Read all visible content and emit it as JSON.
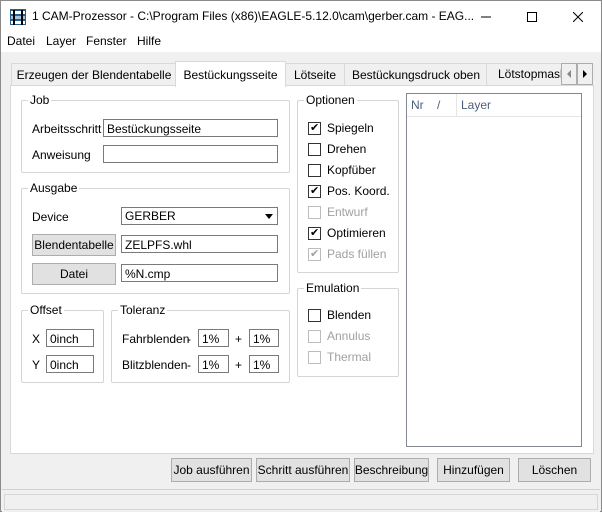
{
  "window": {
    "title": "1 CAM-Prozessor - C:\\Program Files (x86)\\EAGLE-5.12.0\\cam\\gerber.cam - EAG...",
    "minimize_icon": "minimize-icon",
    "maximize_icon": "maximize-icon",
    "close_icon": "close-icon"
  },
  "menu": [
    "Datei",
    "Layer",
    "Fenster",
    "Hilfe"
  ],
  "tabs": [
    {
      "label": "Erzeugen der Blendentabelle"
    },
    {
      "label": "Bestückungsseite"
    },
    {
      "label": "Lötseite"
    },
    {
      "label": "Bestückungsdruck oben"
    },
    {
      "label": "Lötstopmaske"
    }
  ],
  "active_tab": "Bestückungsseite",
  "job": {
    "title": "Job",
    "step_label": "Arbeitsschritt",
    "step_value": "Bestückungsseite",
    "instruction_label": "Anweisung",
    "instruction_value": ""
  },
  "output": {
    "title": "Ausgabe",
    "device_label": "Device",
    "device_value": "GERBER",
    "aperture_button": "Blendentabelle",
    "aperture_value": "ZELPFS.whl",
    "file_button": "Datei",
    "file_value": "%N.cmp"
  },
  "offset": {
    "title": "Offset",
    "x_label": "X",
    "x_value": "0inch",
    "y_label": "Y",
    "y_value": "0inch"
  },
  "tolerance": {
    "title": "Toleranz",
    "draw_label": "Fahrblenden",
    "flash_label": "Blitzblenden",
    "minus": "-",
    "plus": "+",
    "draw_minus": "1%",
    "draw_plus": "1%",
    "flash_minus": "1%",
    "flash_plus": "1%"
  },
  "options": {
    "title": "Optionen",
    "items": [
      {
        "label": "Spiegeln",
        "checked": true,
        "enabled": true
      },
      {
        "label": "Drehen",
        "checked": false,
        "enabled": true
      },
      {
        "label": "Kopfüber",
        "checked": false,
        "enabled": true
      },
      {
        "label": "Pos. Koord.",
        "checked": true,
        "enabled": true
      },
      {
        "label": "Entwurf",
        "checked": false,
        "enabled": false
      },
      {
        "label": "Optimieren",
        "checked": true,
        "enabled": true
      },
      {
        "label": "Pads füllen",
        "checked": true,
        "enabled": false
      }
    ]
  },
  "emulation": {
    "title": "Emulation",
    "items": [
      {
        "label": "Blenden",
        "checked": false,
        "enabled": true
      },
      {
        "label": "Annulus",
        "checked": false,
        "enabled": false
      },
      {
        "label": "Thermal",
        "checked": false,
        "enabled": false
      }
    ]
  },
  "layers": {
    "col_nr": "Nr",
    "sort_mark": "/",
    "col_layer": "Layer"
  },
  "buttons": {
    "run_job": "Job ausführen",
    "run_step": "Schritt ausführen",
    "description": "Beschreibung",
    "add": "Hinzufügen",
    "delete": "Löschen"
  }
}
